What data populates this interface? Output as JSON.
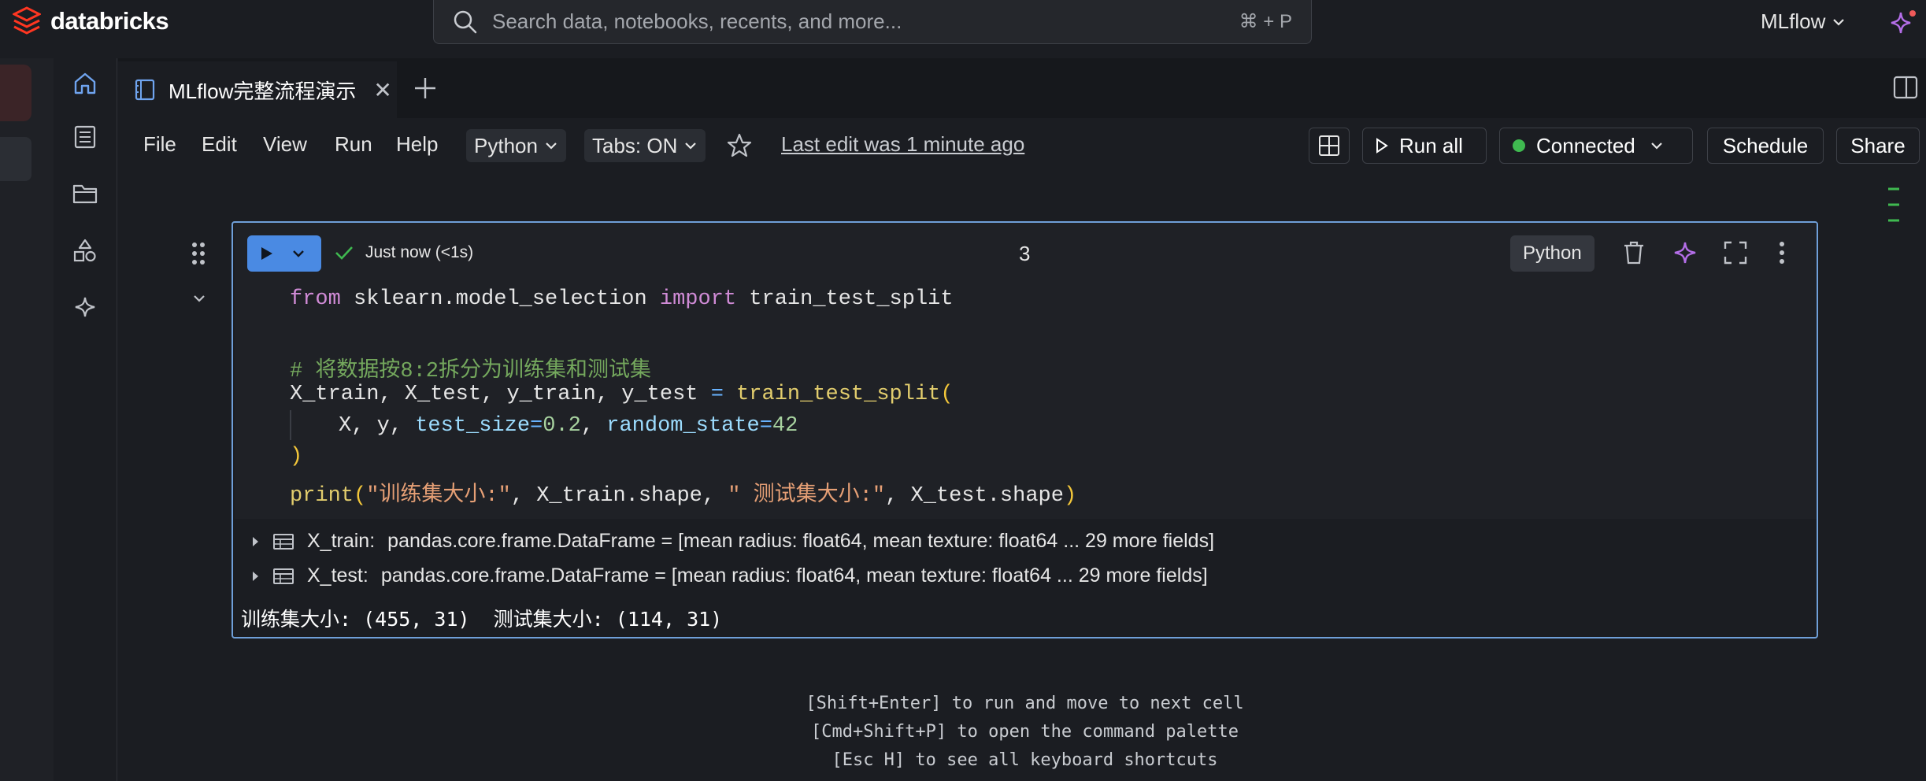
{
  "brand": {
    "name": "databricks"
  },
  "search": {
    "placeholder": "Search data, notebooks, recents, and more...",
    "shortcut": "⌘ + P"
  },
  "workspace": {
    "name": "MLflow"
  },
  "tab": {
    "title": "MLflow完整流程演示",
    "close": "✕"
  },
  "menu": {
    "file": "File",
    "edit": "Edit",
    "view": "View",
    "run": "Run",
    "help": "Help"
  },
  "language_select": "Python",
  "tabs_toggle": "Tabs: ON",
  "last_edit": "Last edit was 1 minute ago",
  "toolbar": {
    "run_all": "Run all",
    "connected": "Connected",
    "schedule": "Schedule",
    "share": "Share"
  },
  "cell": {
    "status": "Just now (<1s)",
    "number": "3",
    "language": "Python",
    "outputs": [
      {
        "name": "X_train:",
        "type": "pandas.core.frame.DataFrame = [mean radius: float64, mean texture: float64 ... 29 more fields]"
      },
      {
        "name": "X_test:",
        "type": "pandas.core.frame.DataFrame = [mean radius: float64, mean texture: float64 ... 29 more fields]"
      }
    ],
    "stdout": "训练集大小: (455, 31)  测试集大小: (114, 31)"
  },
  "code": {
    "l1": {
      "a": "from",
      "b": " sklearn.model_selection ",
      "c": "import",
      "d": " train_test_split"
    },
    "l3": "# 将数据按8:2拆分为训练集和测试集",
    "l4": {
      "a": "X_train, X_test, y_train, y_test ",
      "b": "=",
      "c": " train_test_split",
      "d": "("
    },
    "l5": {
      "a": "X, y, ",
      "b": "test_size",
      "c": "=",
      "d": "0.2",
      "e": ", ",
      "f": "random_state",
      "g": "=",
      "h": "42"
    },
    "l6": ")",
    "l7": {
      "a": "print",
      "b": "(",
      "c": "\"训练集大小:\"",
      "d": ", X_train.shape, ",
      "e": "\" 测试集大小:\"",
      "f": ", X_test.shape",
      "g": ")"
    }
  },
  "hints": [
    "[Shift+Enter] to run and move to next cell",
    "[Cmd+Shift+P] to open the command palette",
    "[Esc H] to see all keyboard shortcuts"
  ],
  "colors": {
    "accent": "#4a8ae3",
    "connected": "#3fb950",
    "cell_border": "#6f9fd8",
    "brand": "#ff3621"
  },
  "icons": [
    "databricks-logo-icon",
    "search-icon",
    "chevron-down-icon",
    "assistant-sparkle-icon",
    "home-icon",
    "notebook-list-icon",
    "folder-icon",
    "shapes-icon",
    "sparkle-icon",
    "notebook-icon",
    "close-icon",
    "plus-icon",
    "panel-toggle-icon",
    "star-icon",
    "layout-icon",
    "play-icon",
    "check-icon",
    "drag-handle-icon",
    "trash-icon",
    "expand-icon",
    "more-vertical-icon",
    "caret-right-icon",
    "table-icon"
  ]
}
